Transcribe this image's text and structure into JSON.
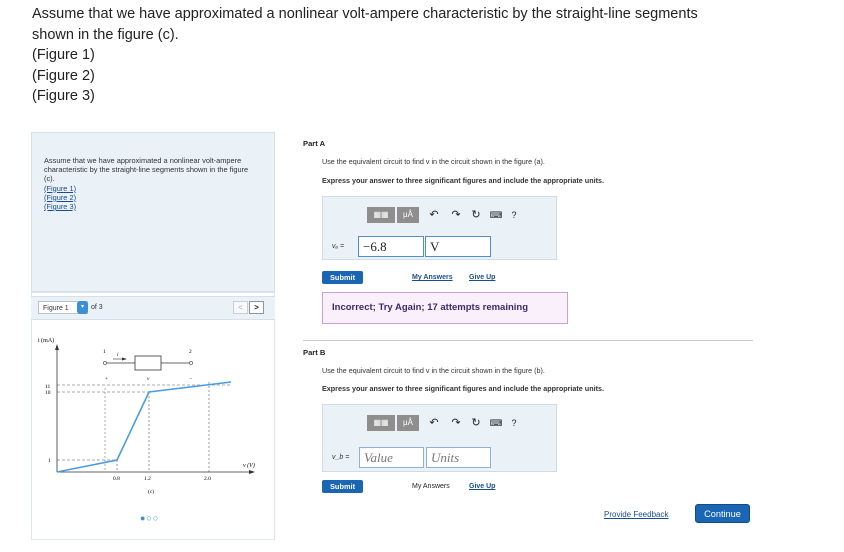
{
  "intro": {
    "line1": "Assume that we have approximated a nonlinear volt-ampere characteristic by the straight-line segments",
    "line2": "shown in the figure (c).",
    "fig1": "(Figure 1)",
    "fig2": "(Figure 2)",
    "fig3": "(Figure 3)"
  },
  "panel": {
    "statement": "Assume that we have approximated a nonlinear volt-ampere characteristic by the straight-line segments shown in the figure (c).",
    "links": [
      "(Figure 1)",
      "(Figure 2)",
      "(Figure 3)"
    ],
    "figure_select": "Figure 1",
    "figure_of": "of 3",
    "prev": "<",
    "next": ">",
    "pager": "●○○"
  },
  "figure": {
    "y_axis_label": "i (mA)",
    "x_axis_label": "v (V)",
    "caption": "(c)",
    "node1": "1",
    "node2": "2",
    "current": "i",
    "plus": "+",
    "minus": "−",
    "v": "v",
    "y_ticks": [
      "11",
      "10",
      "1"
    ],
    "x_ticks": [
      "0.8",
      "1.2",
      "2.0"
    ]
  },
  "partA": {
    "title": "Part A",
    "instruction": "Use the equivalent circuit to find v in the circuit shown in the figure (a).",
    "format": "Express your answer to three significant figures and include the appropriate units.",
    "toolbar": {
      "mu": "μÅ",
      "help": "?"
    },
    "var_label": "vₐ =",
    "value": "−6.8",
    "units": "V",
    "submit": "Submit",
    "my_answers": "My Answers",
    "give_up": "Give Up",
    "feedback": "Incorrect; Try Again; 17 attempts remaining"
  },
  "partB": {
    "title": "Part B",
    "instruction": "Use the equivalent circuit to find v in the circuit shown in the figure (b).",
    "format": "Express your answer to three significant figures and include the appropriate units.",
    "toolbar": {
      "mu": "μÅ",
      "help": "?"
    },
    "var_label": "v_b =",
    "value_placeholder": "Value",
    "units_placeholder": "Units",
    "submit": "Submit",
    "my_answers": "My Answers",
    "give_up": "Give Up"
  },
  "footer": {
    "provide_feedback": "Provide Feedback",
    "continue": "Continue"
  },
  "colors": {
    "accent": "#1a65b4",
    "panel_bg": "#eaf1f7",
    "curve": "#4a9de0"
  }
}
